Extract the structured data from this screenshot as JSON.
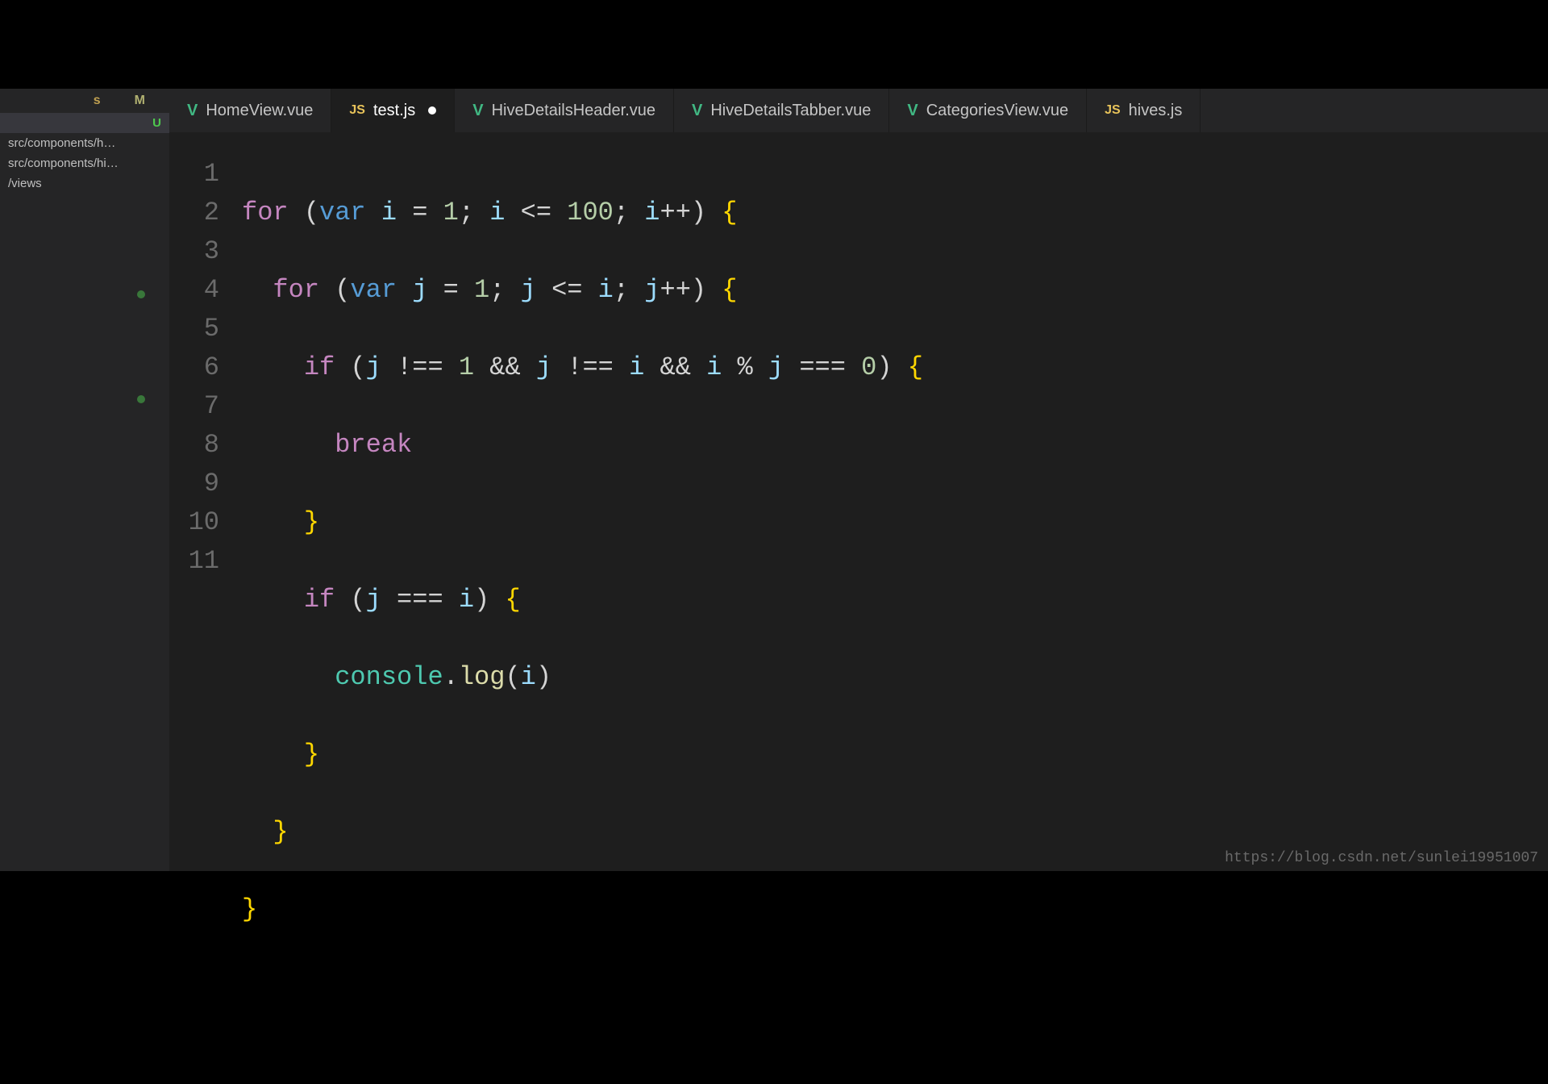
{
  "tabs": [
    {
      "label": "HomeView.vue",
      "icon": "vue",
      "active": false,
      "dirty": false
    },
    {
      "label": "test.js",
      "icon": "js",
      "active": true,
      "dirty": true
    },
    {
      "label": "HiveDetailsHeader.vue",
      "icon": "vue",
      "active": false,
      "dirty": false
    },
    {
      "label": "HiveDetailsTabber.vue",
      "icon": "vue",
      "active": false,
      "dirty": false
    },
    {
      "label": "CategoriesView.vue",
      "icon": "vue",
      "active": false,
      "dirty": false
    },
    {
      "label": "hives.js",
      "icon": "js",
      "active": false,
      "dirty": false
    }
  ],
  "sidebar": {
    "header_cols": [
      "s",
      "M"
    ],
    "rows": [
      {
        "label": "",
        "status": "U",
        "selected": true
      },
      {
        "label": "src/components/h…",
        "status": "",
        "selected": false
      },
      {
        "label": "src/components/hi…",
        "status": "",
        "selected": false
      },
      {
        "label": "/views",
        "status": "",
        "selected": false
      }
    ]
  },
  "gutter": [
    "1",
    "2",
    "3",
    "4",
    "5",
    "6",
    "7",
    "8",
    "9",
    "10",
    "11"
  ],
  "code": {
    "l1": {
      "kw": "for",
      "decl": "var",
      "v1": "i",
      "n1": "1",
      "v2": "i",
      "n2": "100",
      "v3": "i"
    },
    "l2": {
      "kw": "for",
      "decl": "var",
      "v1": "j",
      "n1": "1",
      "v2": "j",
      "v3": "i",
      "v4": "j"
    },
    "l3": {
      "kw": "if",
      "v1": "j",
      "n1": "1",
      "v2": "j",
      "v3": "i",
      "v4": "i",
      "v5": "j",
      "n2": "0"
    },
    "l4": {
      "kw": "break"
    },
    "l6": {
      "kw": "if",
      "v1": "j",
      "v2": "i"
    },
    "l7": {
      "obj": "console",
      "fn": "log",
      "arg": "i"
    }
  },
  "watermark": "https://blog.csdn.net/sunlei19951007"
}
